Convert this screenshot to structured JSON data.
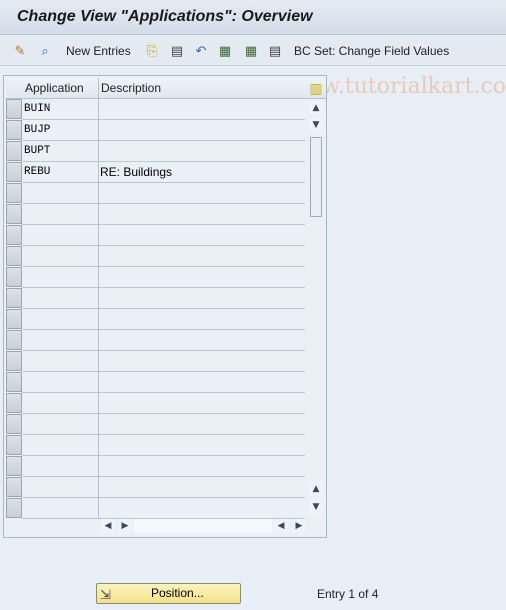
{
  "window": {
    "title": "Change View \"Applications\": Overview"
  },
  "toolbar": {
    "items": [
      {
        "icon": "edit-pencil-icon",
        "glyph": "✎"
      },
      {
        "icon": "display-magnifier-icon",
        "glyph": "🔍"
      },
      {
        "label": "New Entries"
      },
      {
        "icon": "copy-icon",
        "glyph": "⎘"
      },
      {
        "icon": "delete-icon",
        "glyph": "▤"
      },
      {
        "icon": "undo-icon",
        "glyph": "↶"
      },
      {
        "icon": "select-all-icon",
        "glyph": "▦"
      },
      {
        "icon": "select-block-icon",
        "glyph": "▦"
      },
      {
        "icon": "deselect-all-icon",
        "glyph": "▤"
      },
      {
        "label": "BC Set: Change Field Values"
      }
    ],
    "new_entries": "New Entries",
    "bc_set": "BC Set: Change Field Values",
    "watermark": "©www.tutorialkart.com"
  },
  "table": {
    "columns": [
      "Application",
      "Description"
    ],
    "rows": [
      {
        "application": "BUIN",
        "description": ""
      },
      {
        "application": "BUJP",
        "description": ""
      },
      {
        "application": "BUPT",
        "description": ""
      },
      {
        "application": "REBU",
        "description": "RE: Buildings"
      }
    ],
    "visible_rows": 20
  },
  "footer": {
    "position_button": "Position...",
    "entry_status": "Entry 1 of 4"
  },
  "colors": {
    "background": "#e8eef5",
    "button_yellow": "#f3e28a",
    "grid_line": "#bcc7d3"
  }
}
